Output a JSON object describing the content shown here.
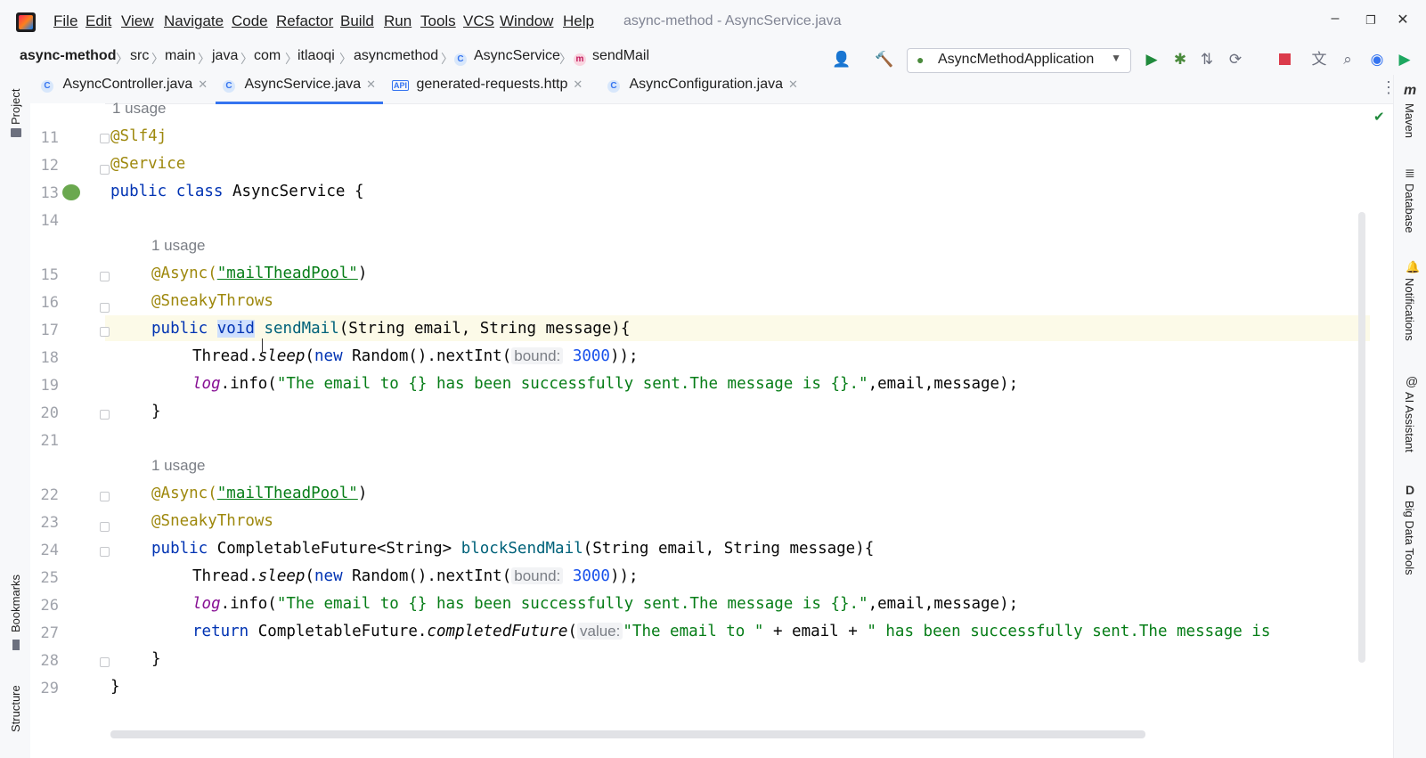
{
  "window": {
    "title": "async-method - AsyncService.java",
    "controls": {
      "minimize": "–",
      "maximize": "❐",
      "close": "✕"
    }
  },
  "menu": [
    "File",
    "Edit",
    "View",
    "Navigate",
    "Code",
    "Refactor",
    "Build",
    "Run",
    "Tools",
    "VCS",
    "Window",
    "Help"
  ],
  "breadcrumb": {
    "project": "async-method",
    "path": [
      "src",
      "main",
      "java",
      "com",
      "itlaoqi",
      "asyncmethod",
      "AsyncService",
      "sendMail"
    ]
  },
  "toolbar": {
    "run_config": "AsyncMethodApplication"
  },
  "tabs": [
    {
      "label": "AsyncController.java",
      "icon": "C"
    },
    {
      "label": "AsyncService.java",
      "icon": "C",
      "active": true
    },
    {
      "label": "generated-requests.http",
      "icon": "API"
    },
    {
      "label": "AsyncConfiguration.java",
      "icon": "C"
    }
  ],
  "left_stripe": {
    "project": "Project",
    "bookmarks": "Bookmarks",
    "structure": "Structure"
  },
  "right_stripe": {
    "maven": "Maven",
    "database": "Database",
    "notifications": "Notifications",
    "ai_assistant": "AI Assistant",
    "big_data_tools": "Big Data Tools"
  },
  "editor": {
    "usage_top": "1 usage",
    "usage_15": "1 usage",
    "usage_22": "1 usage",
    "line_numbers": [
      "11",
      "12",
      "13",
      "14",
      "15",
      "16",
      "17",
      "18",
      "19",
      "20",
      "21",
      "22",
      "23",
      "24",
      "25",
      "26",
      "27",
      "28",
      "29"
    ],
    "l11": "@Slf4j",
    "l12": "@Service",
    "l13_kw": "public class",
    "l13_rest": " AsyncService {",
    "l15_ann": "@Async(",
    "l15_str": "\"mailTheadPool\"",
    "l15_end": ")",
    "l16": "@SneakyThrows",
    "l17_kw": "public",
    "l17_void": "void",
    "l17_meth": "sendMail",
    "l17_rest": "(String email, String message){",
    "l18_a": "Thread.",
    "l18_sleep": "sleep",
    "l18_b": "(",
    "l18_new": "new",
    "l18_c": " Random().nextInt(",
    "hint_bound": "bound:",
    "l18_num": "3000",
    "l18_d": "));",
    "log": "log",
    "l19_a": ".info(",
    "l19_str": "\"The email to {} has been successfully sent.The message is {}.\"",
    "l19_b": ",email,message);",
    "brace_close": "}",
    "l24_kw": "public",
    "l24_type": " CompletableFuture<String> ",
    "l24_meth": "blockSendMail",
    "l24_rest": "(String email, String message){",
    "l27_return": "return",
    "l27_a": " CompletableFuture.",
    "l27_cf": "completedFuture",
    "l27_b": "(",
    "hint_value": "value:",
    "l27_str1": "\"The email to \"",
    "l27_c": " + email + ",
    "l27_str2": "\" has been successfully sent.The message is"
  },
  "colors": {
    "keyword": "#0033b3",
    "annotation": "#9e880d",
    "string": "#067d17",
    "method": "#00627a",
    "accent": "#3574f0"
  }
}
